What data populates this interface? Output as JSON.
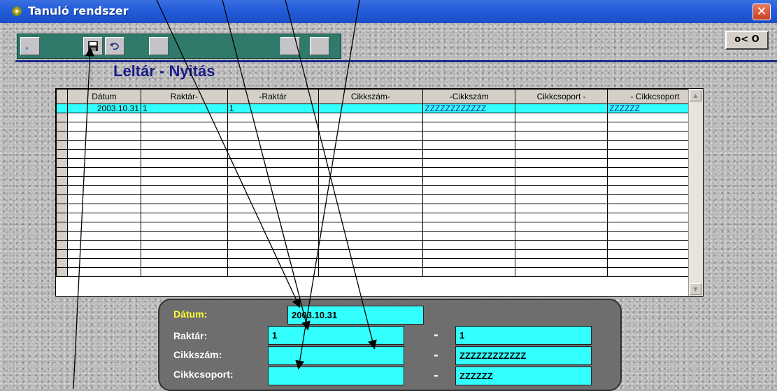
{
  "window": {
    "title": "Tanuló rendszer",
    "close_glyph": "✕"
  },
  "toolbar": {
    "exit_label": "o< O",
    "buttons": [
      "new-record-icon",
      "save-disk-icon",
      "undo-icon",
      "blank-button",
      "blank-button",
      "blank-button"
    ]
  },
  "heading": "Leltár - Nyitás",
  "grid": {
    "columns": [
      "Dátum",
      "Raktár-",
      "-Raktár",
      "Cikkszám-",
      "-Cikkszám",
      "Cikkcsoport -",
      "- Cikkcsoport"
    ],
    "rows": [
      [
        "2003.10.31",
        "1",
        "1",
        "",
        "ZZZZZZZZZZZZ",
        "",
        "ZZZZZZ"
      ]
    ],
    "empty_rows": 18,
    "selected_color": "#33ffff"
  },
  "form": {
    "datum_label": "Dátum:",
    "raktar_label": "Raktár:",
    "cikkszam_label": "Cikkszám:",
    "cikkcsoport_label": "Cikkcsoport:",
    "datum_value": "2003.10.31",
    "raktar_from": "1",
    "raktar_to": "1",
    "cikkszam_from": "",
    "cikkszam_to": "ZZZZZZZZZZZZ",
    "cikkcsoport_from": "",
    "cikkcsoport_to": "ZZZZZZ",
    "dash": "-"
  },
  "colors": {
    "field_bg": "#33ffff",
    "date_label": "#ffff33",
    "heading": "#1b1b8a",
    "toolbar": "#2f7a6a"
  }
}
